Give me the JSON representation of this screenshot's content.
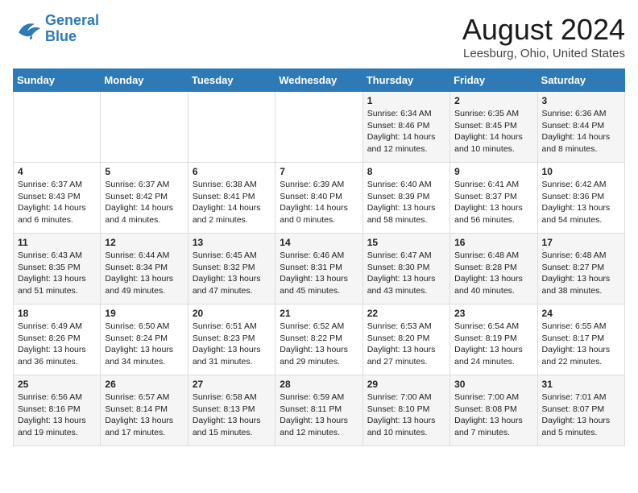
{
  "logo": {
    "line1": "General",
    "line2": "Blue"
  },
  "title": "August 2024",
  "location": "Leesburg, Ohio, United States",
  "weekdays": [
    "Sunday",
    "Monday",
    "Tuesday",
    "Wednesday",
    "Thursday",
    "Friday",
    "Saturday"
  ],
  "weeks": [
    [
      {
        "day": "",
        "sunrise": "",
        "sunset": "",
        "daylight": ""
      },
      {
        "day": "",
        "sunrise": "",
        "sunset": "",
        "daylight": ""
      },
      {
        "day": "",
        "sunrise": "",
        "sunset": "",
        "daylight": ""
      },
      {
        "day": "",
        "sunrise": "",
        "sunset": "",
        "daylight": ""
      },
      {
        "day": "1",
        "sunrise": "Sunrise: 6:34 AM",
        "sunset": "Sunset: 8:46 PM",
        "daylight": "Daylight: 14 hours and 12 minutes."
      },
      {
        "day": "2",
        "sunrise": "Sunrise: 6:35 AM",
        "sunset": "Sunset: 8:45 PM",
        "daylight": "Daylight: 14 hours and 10 minutes."
      },
      {
        "day": "3",
        "sunrise": "Sunrise: 6:36 AM",
        "sunset": "Sunset: 8:44 PM",
        "daylight": "Daylight: 14 hours and 8 minutes."
      }
    ],
    [
      {
        "day": "4",
        "sunrise": "Sunrise: 6:37 AM",
        "sunset": "Sunset: 8:43 PM",
        "daylight": "Daylight: 14 hours and 6 minutes."
      },
      {
        "day": "5",
        "sunrise": "Sunrise: 6:37 AM",
        "sunset": "Sunset: 8:42 PM",
        "daylight": "Daylight: 14 hours and 4 minutes."
      },
      {
        "day": "6",
        "sunrise": "Sunrise: 6:38 AM",
        "sunset": "Sunset: 8:41 PM",
        "daylight": "Daylight: 14 hours and 2 minutes."
      },
      {
        "day": "7",
        "sunrise": "Sunrise: 6:39 AM",
        "sunset": "Sunset: 8:40 PM",
        "daylight": "Daylight: 14 hours and 0 minutes."
      },
      {
        "day": "8",
        "sunrise": "Sunrise: 6:40 AM",
        "sunset": "Sunset: 8:39 PM",
        "daylight": "Daylight: 13 hours and 58 minutes."
      },
      {
        "day": "9",
        "sunrise": "Sunrise: 6:41 AM",
        "sunset": "Sunset: 8:37 PM",
        "daylight": "Daylight: 13 hours and 56 minutes."
      },
      {
        "day": "10",
        "sunrise": "Sunrise: 6:42 AM",
        "sunset": "Sunset: 8:36 PM",
        "daylight": "Daylight: 13 hours and 54 minutes."
      }
    ],
    [
      {
        "day": "11",
        "sunrise": "Sunrise: 6:43 AM",
        "sunset": "Sunset: 8:35 PM",
        "daylight": "Daylight: 13 hours and 51 minutes."
      },
      {
        "day": "12",
        "sunrise": "Sunrise: 6:44 AM",
        "sunset": "Sunset: 8:34 PM",
        "daylight": "Daylight: 13 hours and 49 minutes."
      },
      {
        "day": "13",
        "sunrise": "Sunrise: 6:45 AM",
        "sunset": "Sunset: 8:32 PM",
        "daylight": "Daylight: 13 hours and 47 minutes."
      },
      {
        "day": "14",
        "sunrise": "Sunrise: 6:46 AM",
        "sunset": "Sunset: 8:31 PM",
        "daylight": "Daylight: 13 hours and 45 minutes."
      },
      {
        "day": "15",
        "sunrise": "Sunrise: 6:47 AM",
        "sunset": "Sunset: 8:30 PM",
        "daylight": "Daylight: 13 hours and 43 minutes."
      },
      {
        "day": "16",
        "sunrise": "Sunrise: 6:48 AM",
        "sunset": "Sunset: 8:28 PM",
        "daylight": "Daylight: 13 hours and 40 minutes."
      },
      {
        "day": "17",
        "sunrise": "Sunrise: 6:48 AM",
        "sunset": "Sunset: 8:27 PM",
        "daylight": "Daylight: 13 hours and 38 minutes."
      }
    ],
    [
      {
        "day": "18",
        "sunrise": "Sunrise: 6:49 AM",
        "sunset": "Sunset: 8:26 PM",
        "daylight": "Daylight: 13 hours and 36 minutes."
      },
      {
        "day": "19",
        "sunrise": "Sunrise: 6:50 AM",
        "sunset": "Sunset: 8:24 PM",
        "daylight": "Daylight: 13 hours and 34 minutes."
      },
      {
        "day": "20",
        "sunrise": "Sunrise: 6:51 AM",
        "sunset": "Sunset: 8:23 PM",
        "daylight": "Daylight: 13 hours and 31 minutes."
      },
      {
        "day": "21",
        "sunrise": "Sunrise: 6:52 AM",
        "sunset": "Sunset: 8:22 PM",
        "daylight": "Daylight: 13 hours and 29 minutes."
      },
      {
        "day": "22",
        "sunrise": "Sunrise: 6:53 AM",
        "sunset": "Sunset: 8:20 PM",
        "daylight": "Daylight: 13 hours and 27 minutes."
      },
      {
        "day": "23",
        "sunrise": "Sunrise: 6:54 AM",
        "sunset": "Sunset: 8:19 PM",
        "daylight": "Daylight: 13 hours and 24 minutes."
      },
      {
        "day": "24",
        "sunrise": "Sunrise: 6:55 AM",
        "sunset": "Sunset: 8:17 PM",
        "daylight": "Daylight: 13 hours and 22 minutes."
      }
    ],
    [
      {
        "day": "25",
        "sunrise": "Sunrise: 6:56 AM",
        "sunset": "Sunset: 8:16 PM",
        "daylight": "Daylight: 13 hours and 19 minutes."
      },
      {
        "day": "26",
        "sunrise": "Sunrise: 6:57 AM",
        "sunset": "Sunset: 8:14 PM",
        "daylight": "Daylight: 13 hours and 17 minutes."
      },
      {
        "day": "27",
        "sunrise": "Sunrise: 6:58 AM",
        "sunset": "Sunset: 8:13 PM",
        "daylight": "Daylight: 13 hours and 15 minutes."
      },
      {
        "day": "28",
        "sunrise": "Sunrise: 6:59 AM",
        "sunset": "Sunset: 8:11 PM",
        "daylight": "Daylight: 13 hours and 12 minutes."
      },
      {
        "day": "29",
        "sunrise": "Sunrise: 7:00 AM",
        "sunset": "Sunset: 8:10 PM",
        "daylight": "Daylight: 13 hours and 10 minutes."
      },
      {
        "day": "30",
        "sunrise": "Sunrise: 7:00 AM",
        "sunset": "Sunset: 8:08 PM",
        "daylight": "Daylight: 13 hours and 7 minutes."
      },
      {
        "day": "31",
        "sunrise": "Sunrise: 7:01 AM",
        "sunset": "Sunset: 8:07 PM",
        "daylight": "Daylight: 13 hours and 5 minutes."
      }
    ]
  ]
}
